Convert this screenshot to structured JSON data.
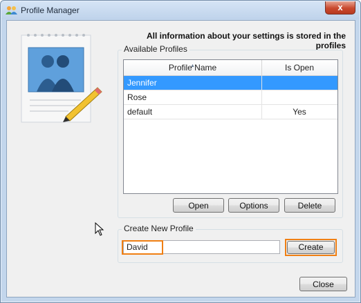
{
  "window": {
    "title": "Profile Manager",
    "close_glyph": "x"
  },
  "main": {
    "heading": "All information about your settings is stored in the profiles"
  },
  "available_profiles": {
    "label": "Available Profiles",
    "columns": [
      "Profile Name",
      "Is Open"
    ],
    "rows": [
      {
        "name": "Jennifer",
        "is_open": "",
        "selected": true
      },
      {
        "name": "Rose",
        "is_open": "",
        "selected": false
      },
      {
        "name": "default",
        "is_open": "Yes",
        "selected": false
      }
    ],
    "buttons": {
      "open": "Open",
      "options": "Options",
      "delete": "Delete"
    }
  },
  "create_profile": {
    "label": "Create New Profile",
    "input_value": "David",
    "create_button": "Create"
  },
  "footer": {
    "close_button": "Close"
  },
  "colors": {
    "selection": "#3399ff",
    "highlight": "#f07f13"
  }
}
